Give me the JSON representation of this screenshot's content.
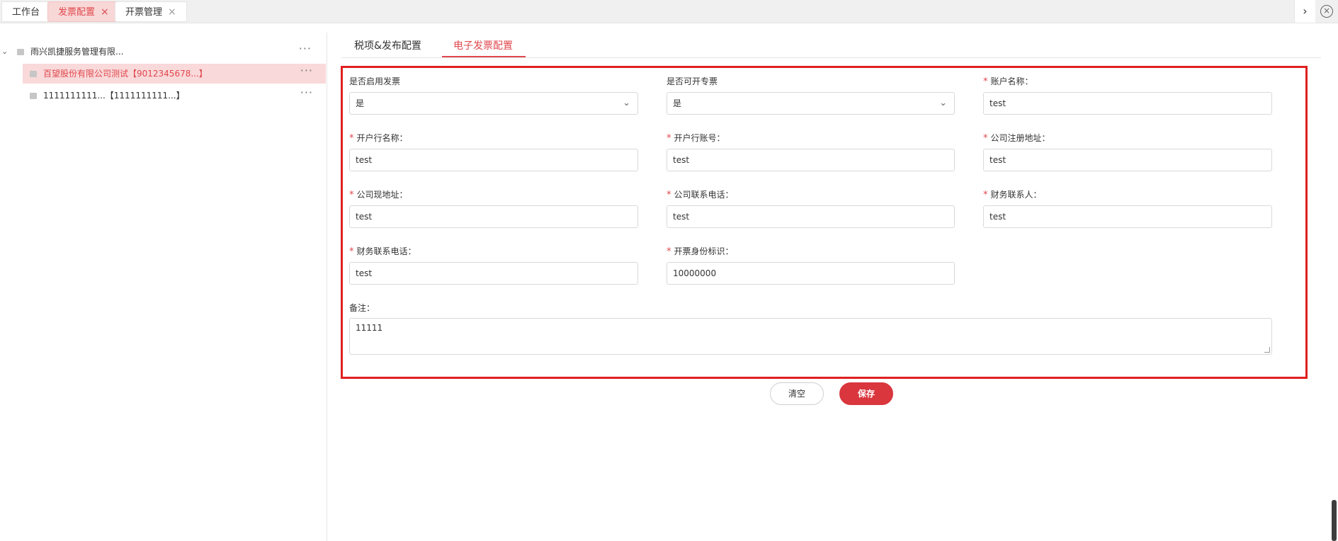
{
  "topbar": {
    "tabs": [
      {
        "label": "工作台",
        "closable": false
      },
      {
        "label": "发票配置",
        "closable": true,
        "active": true
      },
      {
        "label": "开票管理",
        "closable": true
      }
    ],
    "close_glyph": "×",
    "next_glyph": "›",
    "close_all_glyph": "×"
  },
  "sidebar": {
    "caret": "⌄",
    "dots": "···",
    "items": [
      {
        "label": "雨兴凯捷服务管理有限..."
      },
      {
        "label": "百望股份有限公司测试【9012345678...】",
        "selected": true
      },
      {
        "label": "1111111111...【1111111111...】"
      }
    ]
  },
  "content_tabs": [
    {
      "label": "税项&发布配置"
    },
    {
      "label": "电子发票配置",
      "active": true
    }
  ],
  "form": {
    "required_mark": "*",
    "enable_invoice": {
      "label": "是否启用发票",
      "value": "是"
    },
    "special_invoice": {
      "label": "是否可开专票",
      "value": "是"
    },
    "account_name": {
      "label": "账户名称：",
      "value": "test"
    },
    "bank_name": {
      "label": "开户行名称：",
      "value": "test"
    },
    "bank_account": {
      "label": "开户行账号：",
      "value": "test"
    },
    "reg_address": {
      "label": "公司注册地址：",
      "value": "test"
    },
    "cur_address": {
      "label": "公司现地址：",
      "value": "test"
    },
    "company_phone": {
      "label": "公司联系电话：",
      "value": "test"
    },
    "finance_contact": {
      "label": "财务联系人：",
      "value": "test"
    },
    "finance_phone": {
      "label": "财务联系电话：",
      "value": "test"
    },
    "issuer_id": {
      "label": "开票身份标识：",
      "value": "10000000"
    },
    "remark": {
      "label": "备注：",
      "value": "11111"
    },
    "chevron": "⌄"
  },
  "actions": {
    "clear_label": "清空",
    "save_label": "保存"
  },
  "colors": {
    "accent": "#e0474c",
    "save_button": "#d9363e",
    "highlight_border": "#e02020",
    "selected_row_bg": "#f9d9da"
  }
}
